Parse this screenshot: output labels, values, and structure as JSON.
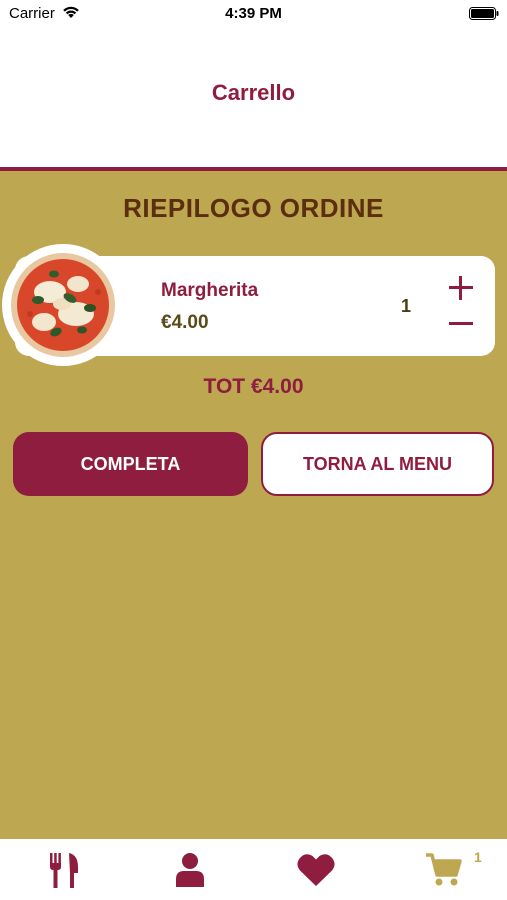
{
  "status_bar": {
    "carrier": "Carrier",
    "time": "4:39 PM"
  },
  "header": {
    "title": "Carrello"
  },
  "summary": {
    "title": "RIEPILOGO ORDINE"
  },
  "cart": {
    "items": [
      {
        "name": "Margherita",
        "price": "€4.00",
        "quantity": "1",
        "image_icon": "pizza-image"
      }
    ],
    "total": "TOT €4.00"
  },
  "actions": {
    "complete_label": "COMPLETA",
    "back_to_menu_label": "TORNA AL MENU"
  },
  "tab_bar": {
    "items": [
      {
        "icon": "fork-knife-icon",
        "active": false
      },
      {
        "icon": "user-icon",
        "active": false
      },
      {
        "icon": "heart-icon",
        "active": false
      },
      {
        "icon": "cart-icon",
        "active": true,
        "badge": "1"
      }
    ]
  },
  "colors": {
    "primary": "#8e1d3f",
    "background": "#bea751",
    "title_brown": "#5a2e0e",
    "tab_active": "#bea751"
  }
}
